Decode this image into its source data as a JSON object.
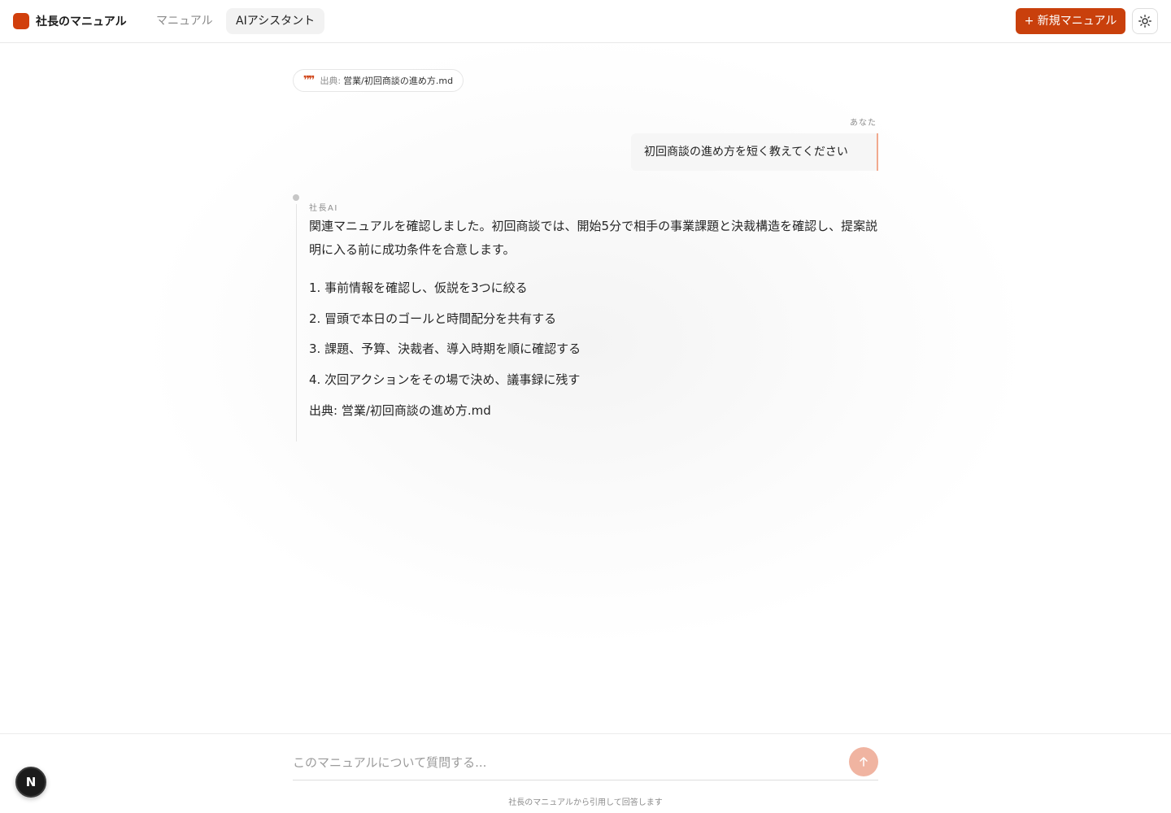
{
  "header": {
    "brand": "社長のマニュアル",
    "nav": [
      {
        "label": "マニュアル"
      },
      {
        "label": "AIアシスタント"
      }
    ],
    "new_button_label": "+ 新規マニュアル",
    "theme_icon": "sun-icon",
    "brand_color": "#d13f0c"
  },
  "source_chip": {
    "icon": "quote-icon",
    "label": "出典:",
    "file": "営業/初回商談の進め方.md"
  },
  "user_message": {
    "author": "あなた",
    "text": "初回商談の進め方を短く教えてください"
  },
  "ai_message": {
    "author": "社長AI",
    "paragraph": "関連マニュアルを確認しました。初回商談では、開始5分で相手の事業課題と決裁構造を確認し、提案説明に入る前に成功条件を合意します。",
    "steps": [
      "1. 事前情報を確認し、仮説を3つに絞る",
      "2. 冒頭で本日のゴールと時間配分を共有する",
      "3. 課題、予算、決裁者、導入時期を順に確認する",
      "4. 次回アクションをその場で決め、議事録に残す"
    ],
    "source": "出典: 営業/初回商談の進め方.md"
  },
  "composer": {
    "placeholder": "このマニュアルについて質問する...",
    "send_icon": "arrow-up-icon",
    "footnote": "社長のマニュアルから引用して回答します"
  },
  "dev_badge": {
    "letter": "N"
  }
}
